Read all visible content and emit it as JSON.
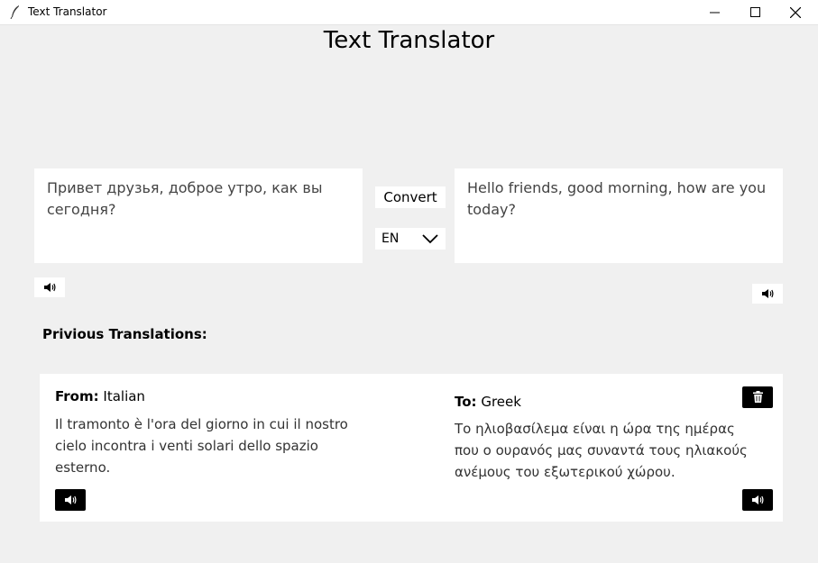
{
  "window": {
    "title": "Text Translator"
  },
  "header": {
    "title": "Text Translator"
  },
  "translator": {
    "source_text": "Привет друзья, доброе утро, как вы сегодня?",
    "convert_label": "Convert",
    "target_language": "EN",
    "output_text": "Hello friends, good morning, how are you today?"
  },
  "history": {
    "section_title": "Privious Translations:",
    "items": [
      {
        "from_label": "From:",
        "from_lang": "Italian",
        "from_text": " Il tramonto è l'ora del giorno in cui il nostro cielo incontra i venti solari dello spazio esterno.",
        "to_label": "To:",
        "to_lang": "Greek",
        "to_text": "Το ηλιοβασίλεμα είναι η ώρα της ημέρας που ο ουρανός μας συναντά τους ηλιακούς ανέμους του εξωτερικού χώρου."
      }
    ]
  },
  "icons": {
    "speaker": "speaker-icon",
    "trash": "trash-icon",
    "chevron": "chevron-down-icon",
    "minimize": "minimize-icon",
    "maximize": "maximize-icon",
    "close": "close-icon",
    "app": "feather-icon"
  }
}
